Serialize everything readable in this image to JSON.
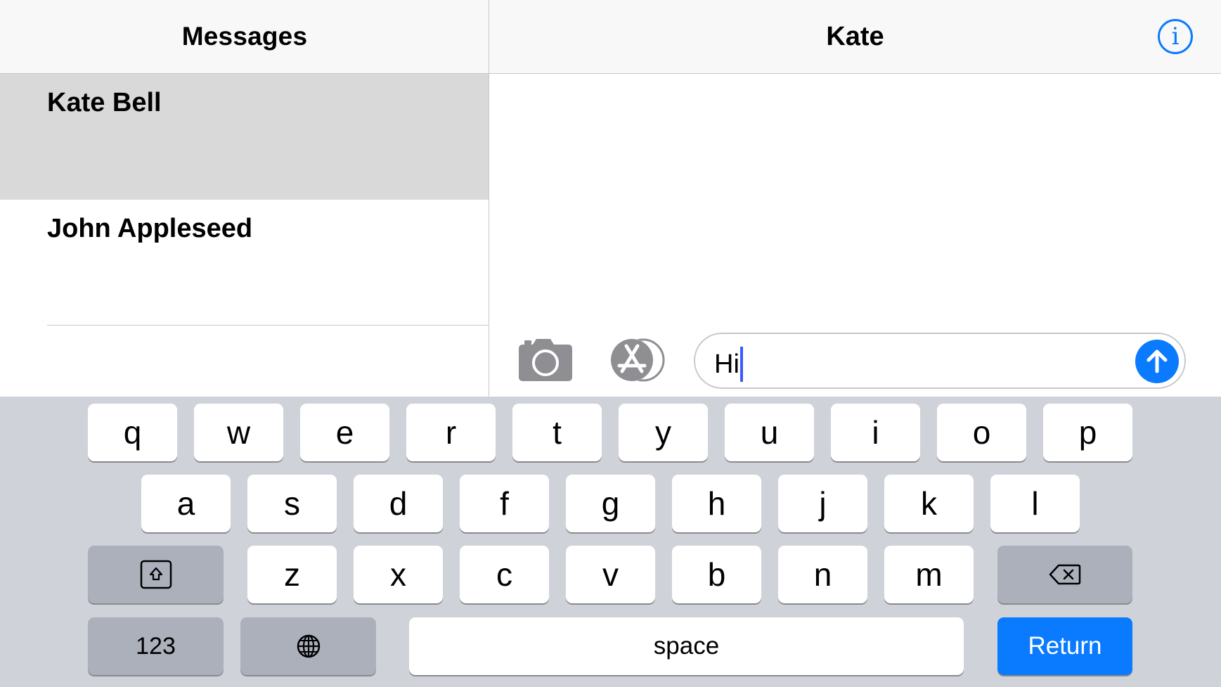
{
  "sidebar": {
    "title": "Messages",
    "conversations": [
      {
        "name": "Kate Bell",
        "selected": true
      },
      {
        "name": "John Appleseed",
        "selected": false
      }
    ]
  },
  "detail": {
    "title": "Kate",
    "info_icon": "info-icon"
  },
  "composer": {
    "camera_icon": "camera-icon",
    "appstore_icon": "app-store-icon",
    "message_value": "Hi",
    "send_icon": "arrow-up-icon"
  },
  "keyboard": {
    "row1": [
      "q",
      "w",
      "e",
      "r",
      "t",
      "y",
      "u",
      "i",
      "o",
      "p"
    ],
    "row2": [
      "a",
      "s",
      "d",
      "f",
      "g",
      "h",
      "j",
      "k",
      "l"
    ],
    "row3": [
      "z",
      "x",
      "c",
      "v",
      "b",
      "n",
      "m"
    ],
    "numbers_label": "123",
    "space_label": "space",
    "return_label": "Return",
    "shift_icon": "shift-icon",
    "delete_icon": "backspace-icon",
    "globe_icon": "globe-icon"
  },
  "colors": {
    "accent": "#0a7aff",
    "keyboard_bg": "#cfd3d9",
    "selected_row": "#d9d9d9"
  }
}
